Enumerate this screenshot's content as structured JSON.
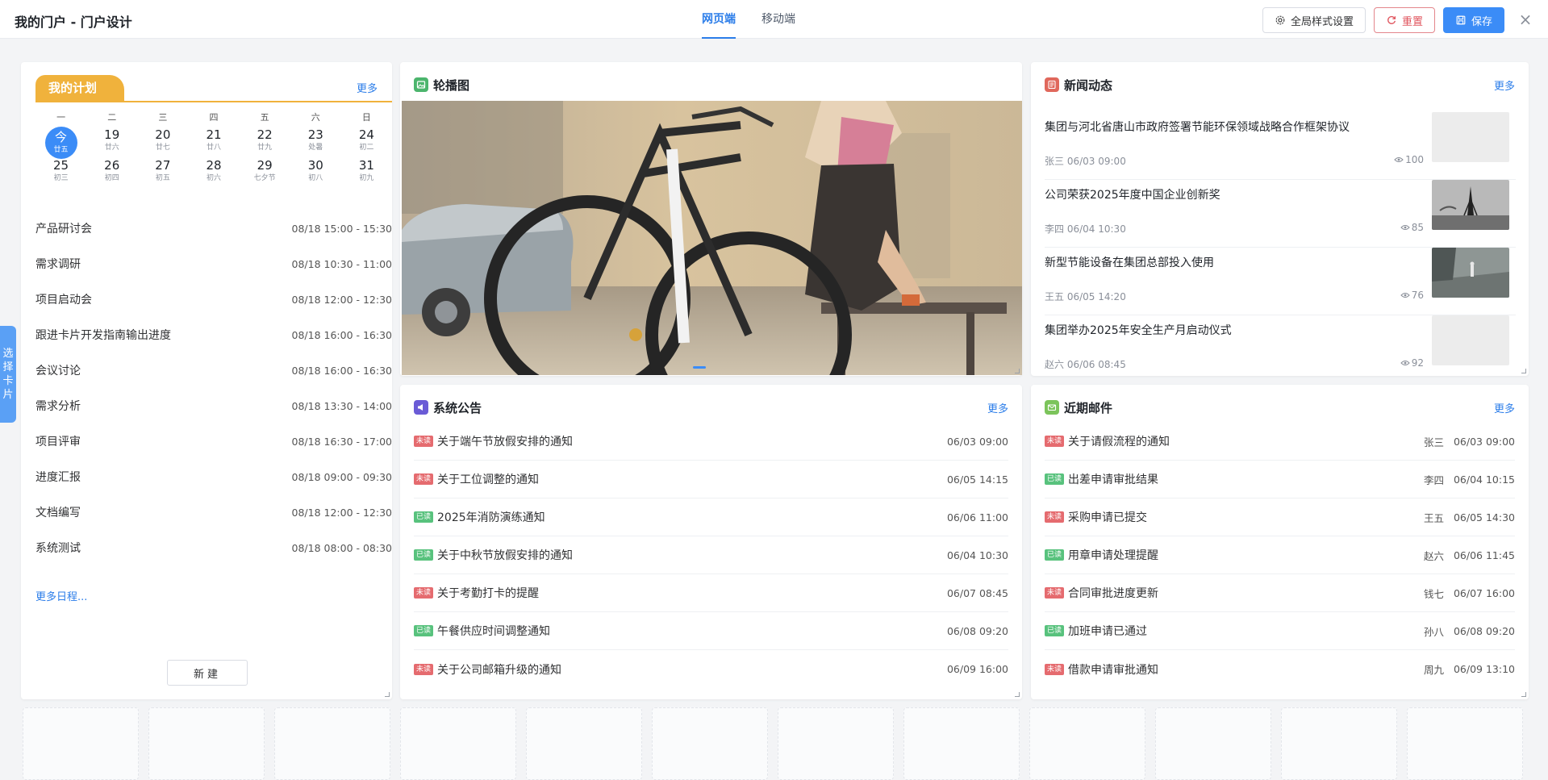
{
  "header": {
    "title": "我的门户 - 门户设计",
    "tabs": [
      {
        "label": "网页端",
        "active": true
      },
      {
        "label": "移动端",
        "active": false
      }
    ],
    "global_style_label": "全局样式设置",
    "reset_label": "重置",
    "save_label": "保存",
    "close_glyph": "×"
  },
  "side_tab": {
    "label": [
      "选",
      "择",
      "卡",
      "片"
    ]
  },
  "plan": {
    "title": "我的计划",
    "more": "更多",
    "weekdays": [
      "一",
      "二",
      "三",
      "四",
      "五",
      "六",
      "日"
    ],
    "weeks": [
      [
        {
          "day": "今",
          "lunar": "廿五",
          "today": true
        },
        {
          "day": "19",
          "lunar": "廿六"
        },
        {
          "day": "20",
          "lunar": "廿七"
        },
        {
          "day": "21",
          "lunar": "廿八"
        },
        {
          "day": "22",
          "lunar": "廿九"
        },
        {
          "day": "23",
          "lunar": "处暑"
        },
        {
          "day": "24",
          "lunar": "初二"
        }
      ],
      [
        {
          "day": "25",
          "lunar": "初三"
        },
        {
          "day": "26",
          "lunar": "初四"
        },
        {
          "day": "27",
          "lunar": "初五"
        },
        {
          "day": "28",
          "lunar": "初六"
        },
        {
          "day": "29",
          "lunar": "七夕节"
        },
        {
          "day": "30",
          "lunar": "初八"
        },
        {
          "day": "31",
          "lunar": "初九"
        }
      ]
    ],
    "schedules": [
      {
        "name": "产品研讨会",
        "time": "08/18 15:00 - 15:30"
      },
      {
        "name": "需求调研",
        "time": "08/18 10:30 - 11:00"
      },
      {
        "name": "项目启动会",
        "time": "08/18 12:00 - 12:30"
      },
      {
        "name": "跟进卡片开发指南输出进度",
        "time": "08/18 16:00 - 16:30"
      },
      {
        "name": "会议讨论",
        "time": "08/18 16:00 - 16:30"
      },
      {
        "name": "需求分析",
        "time": "08/18 13:30 - 14:00"
      },
      {
        "name": "项目评审",
        "time": "08/18 16:30 - 17:00"
      },
      {
        "name": "进度汇报",
        "time": "08/18 09:00 - 09:30"
      },
      {
        "name": "文档编写",
        "time": "08/18 12:00 - 12:30"
      },
      {
        "name": "系统测试",
        "time": "08/18 08:00 - 08:30"
      }
    ],
    "more_schedules": "更多日程...",
    "new_label": "新建"
  },
  "carousel": {
    "title": "轮播图",
    "dot_count": 1
  },
  "news": {
    "title": "新闻动态",
    "more": "更多",
    "items": [
      {
        "title": "集团与河北省唐山市政府签署节能环保领域战略合作框架协议",
        "author": "张三",
        "time": "06/03 09:00",
        "views": "100",
        "thumb": "blank"
      },
      {
        "title": "公司荣获2025年度中国企业创新奖",
        "author": "李四",
        "time": "06/04 10:30",
        "views": "85",
        "thumb": "eiffel"
      },
      {
        "title": "新型节能设备在集团总部投入使用",
        "author": "王五",
        "time": "06/05 14:20",
        "views": "76",
        "thumb": "street"
      },
      {
        "title": "集团举办2025年安全生产月启动仪式",
        "author": "赵六",
        "time": "06/06 08:45",
        "views": "92",
        "thumb": "blank"
      }
    ]
  },
  "notices": {
    "title": "系统公告",
    "more": "更多",
    "unread_label": "未读",
    "read_label": "已读",
    "items": [
      {
        "read": false,
        "title": "关于端午节放假安排的通知",
        "date": "06/03 09:00"
      },
      {
        "read": false,
        "title": "关于工位调整的通知",
        "date": "06/05 14:15"
      },
      {
        "read": true,
        "title": "2025年消防演练通知",
        "date": "06/06 11:00"
      },
      {
        "read": true,
        "title": "关于中秋节放假安排的通知",
        "date": "06/04 10:30"
      },
      {
        "read": false,
        "title": "关于考勤打卡的提醒",
        "date": "06/07 08:45"
      },
      {
        "read": true,
        "title": "午餐供应时间调整通知",
        "date": "06/08 09:20"
      },
      {
        "read": false,
        "title": "关于公司邮箱升级的通知",
        "date": "06/09 16:00"
      }
    ]
  },
  "mails": {
    "title": "近期邮件",
    "more": "更多",
    "unread_label": "未读",
    "read_label": "已读",
    "items": [
      {
        "read": false,
        "title": "关于请假流程的通知",
        "sender": "张三",
        "date": "06/03 09:00"
      },
      {
        "read": true,
        "title": "出差申请审批结果",
        "sender": "李四",
        "date": "06/04 10:15"
      },
      {
        "read": false,
        "title": "采购申请已提交",
        "sender": "王五",
        "date": "06/05 14:30"
      },
      {
        "read": true,
        "title": "用章申请处理提醒",
        "sender": "赵六",
        "date": "06/06 11:45"
      },
      {
        "read": false,
        "title": "合同审批进度更新",
        "sender": "钱七",
        "date": "06/07 16:00"
      },
      {
        "read": true,
        "title": "加班申请已通过",
        "sender": "孙八",
        "date": "06/08 09:20"
      },
      {
        "read": false,
        "title": "借款申请审批通知",
        "sender": "周九",
        "date": "06/09 13:10"
      }
    ]
  },
  "colors": {
    "accent": "#3b8cf7",
    "plan": "#f0b23c",
    "unread": "#e56b6f",
    "read": "#58c27d"
  }
}
